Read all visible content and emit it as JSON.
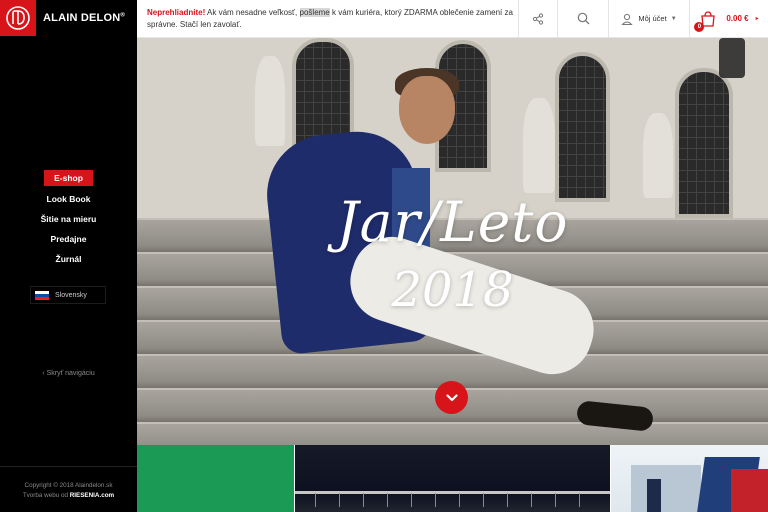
{
  "brand": {
    "name": "ALAIN DELON",
    "mark": "AD",
    "registered": "®"
  },
  "nav": {
    "items": [
      {
        "label": "E-shop",
        "active": true
      },
      {
        "label": "Look Book",
        "active": false
      },
      {
        "label": "Šitie na mieru",
        "active": false
      },
      {
        "label": "Predajne",
        "active": false
      },
      {
        "label": "Žurnál",
        "active": false
      }
    ]
  },
  "language": {
    "label": "Slovensky",
    "flag_colors": [
      "#ffffff",
      "#0b4ea2",
      "#ee1c25"
    ]
  },
  "hide_nav": {
    "arrow": "‹",
    "label": "Skryť navigáciu"
  },
  "footer": {
    "copyright": "Copyright © 2018 Alaindelon.sk",
    "credit_prefix": "Tvorba webu od ",
    "credit_brand": "RIESENIA.com"
  },
  "notice": {
    "warning": "Neprehliadnite!",
    "text_before": " Ak vám nesadne veľkosť, ",
    "highlight": "pošleme",
    "text_after": " k vám kuriéra, ktorý ZDARMA oblečenie zamení za správne. Stačí len zavolať."
  },
  "toolbar": {
    "share_icon": "share-icon",
    "search_icon": "search-icon",
    "account_label": "Môj účet",
    "cart_count": "0",
    "cart_total": "0.00 €",
    "cart_arrow": "▸"
  },
  "hero": {
    "title": "Jar/Leto",
    "year": "2018",
    "scroll_icon": "chevron-down-icon"
  },
  "colors": {
    "brand_red": "#d8141b",
    "sidebar_bg": "#000000",
    "tile_green": "#1a9a55"
  }
}
